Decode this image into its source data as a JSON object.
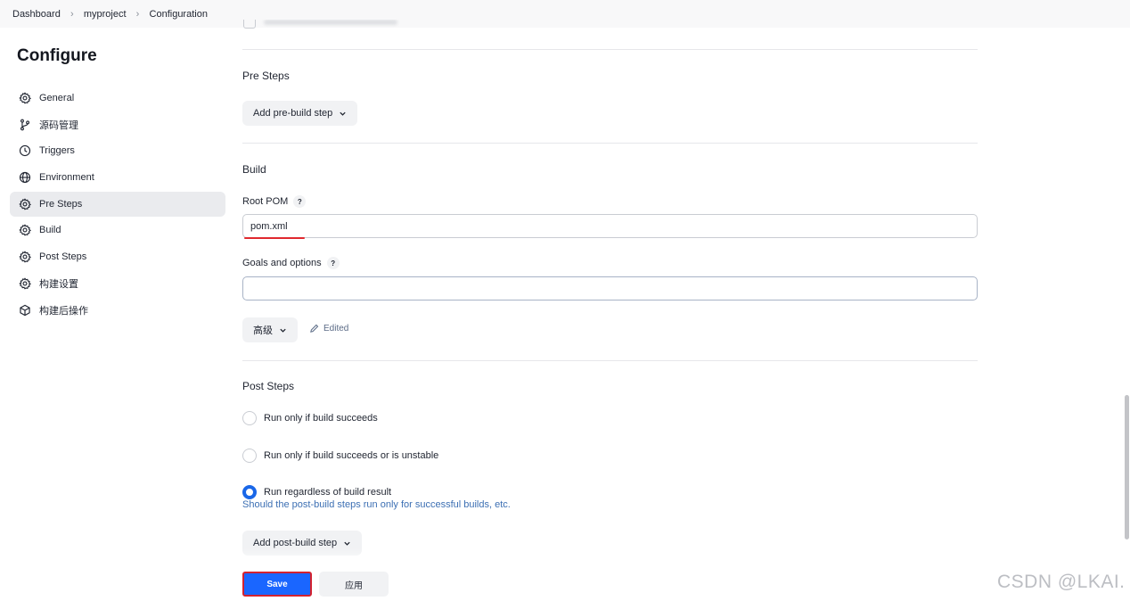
{
  "breadcrumbs": [
    "Dashboard",
    "myproject",
    "Configuration"
  ],
  "page_title": "Configure",
  "sidebar": {
    "items": [
      {
        "label": "General",
        "icon": "gear-icon",
        "active": false
      },
      {
        "label": "源码管理",
        "icon": "branch-icon",
        "active": false
      },
      {
        "label": "Triggers",
        "icon": "clock-icon",
        "active": false
      },
      {
        "label": "Environment",
        "icon": "globe-icon",
        "active": false
      },
      {
        "label": "Pre Steps",
        "icon": "gear-icon",
        "active": true
      },
      {
        "label": "Build",
        "icon": "gear-icon",
        "active": false
      },
      {
        "label": "Post Steps",
        "icon": "gear-icon",
        "active": false
      },
      {
        "label": "构建设置",
        "icon": "gear-icon",
        "active": false
      },
      {
        "label": "构建后操作",
        "icon": "cube-icon",
        "active": false
      }
    ]
  },
  "pre_steps": {
    "title": "Pre Steps",
    "add_button": "Add pre-build step"
  },
  "build": {
    "title": "Build",
    "root_pom_label": "Root POM",
    "root_pom_value": "pom.xml",
    "goals_label": "Goals and options",
    "goals_value": "",
    "advanced_button": "高级",
    "edited_label": "Edited"
  },
  "help_glyph": "?",
  "post_steps": {
    "title": "Post Steps",
    "options": [
      {
        "label": "Run only if build succeeds",
        "checked": false
      },
      {
        "label": "Run only if build succeeds or is unstable",
        "checked": false
      },
      {
        "label": "Run regardless of build result",
        "checked": true
      }
    ],
    "hint": "Should the post-build steps run only for successful builds, etc.",
    "add_button": "Add post-build step"
  },
  "footer": {
    "save_label": "Save",
    "apply_label": "应用"
  },
  "watermark": "CSDN @LKAI.",
  "colors": {
    "primary": "#1a66ff",
    "highlight_red": "#d3222f",
    "radio_checked": "#1a67e8",
    "hint_text": "#3c6fb3"
  }
}
